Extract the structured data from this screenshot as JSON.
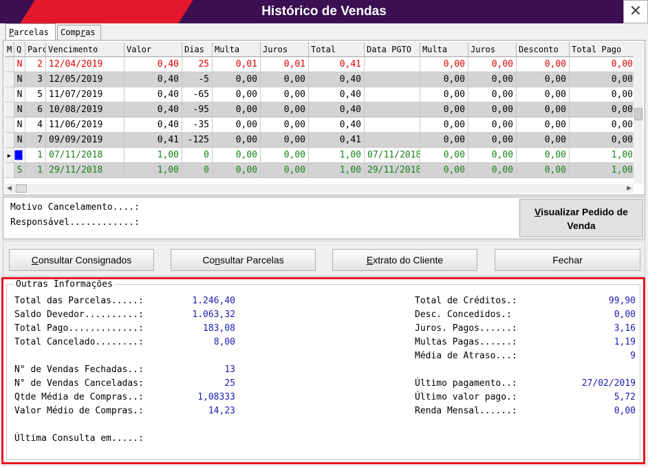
{
  "window": {
    "title": "Histórico de Vendas",
    "close_glyph": "✕"
  },
  "tabs": [
    {
      "pre": "",
      "accel": "P",
      "post": "arcelas"
    },
    {
      "pre": "Comp",
      "accel": "r",
      "post": "as"
    }
  ],
  "grid": {
    "headers": [
      "M",
      "Q",
      "Parc",
      "Vencimento",
      "Valor",
      "Dias",
      "Multa",
      "Juros",
      "Total",
      "Data PGTO",
      "Multa",
      "Juros",
      "Desconto",
      "Total Pago"
    ],
    "rows": [
      {
        "color": "red",
        "m": "",
        "q": "N",
        "parc": "2",
        "venc": "12/04/2019",
        "valor": "0,40",
        "dias": "25",
        "multa": "0,01",
        "juros": "0,01",
        "total": "0,41",
        "data_pgto": "",
        "multa2": "0,00",
        "juros2": "0,00",
        "desconto": "0,00",
        "total_pago": "0,00"
      },
      {
        "color": "black",
        "m": "",
        "q": "N",
        "parc": "3",
        "venc": "12/05/2019",
        "valor": "0,40",
        "dias": "-5",
        "multa": "0,00",
        "juros": "0,00",
        "total": "0,40",
        "data_pgto": "",
        "multa2": "0,00",
        "juros2": "0,00",
        "desconto": "0,00",
        "total_pago": "0,00"
      },
      {
        "color": "black",
        "m": "",
        "q": "N",
        "parc": "5",
        "venc": "11/07/2019",
        "valor": "0,40",
        "dias": "-65",
        "multa": "0,00",
        "juros": "0,00",
        "total": "0,40",
        "data_pgto": "",
        "multa2": "0,00",
        "juros2": "0,00",
        "desconto": "0,00",
        "total_pago": "0,00"
      },
      {
        "color": "black",
        "m": "",
        "q": "N",
        "parc": "6",
        "venc": "10/08/2019",
        "valor": "0,40",
        "dias": "-95",
        "multa": "0,00",
        "juros": "0,00",
        "total": "0,40",
        "data_pgto": "",
        "multa2": "0,00",
        "juros2": "0,00",
        "desconto": "0,00",
        "total_pago": "0,00"
      },
      {
        "color": "black",
        "m": "",
        "q": "N",
        "parc": "4",
        "venc": "11/06/2019",
        "valor": "0,40",
        "dias": "-35",
        "multa": "0,00",
        "juros": "0,00",
        "total": "0,40",
        "data_pgto": "",
        "multa2": "0,00",
        "juros2": "0,00",
        "desconto": "0,00",
        "total_pago": "0,00"
      },
      {
        "color": "black",
        "m": "",
        "q": "N",
        "parc": "7",
        "venc": "09/09/2019",
        "valor": "0,41",
        "dias": "-125",
        "multa": "0,00",
        "juros": "0,00",
        "total": "0,41",
        "data_pgto": "",
        "multa2": "0,00",
        "juros2": "0,00",
        "desconto": "0,00",
        "total_pago": "0,00"
      },
      {
        "color": "green",
        "m": "",
        "q": "S",
        "parc": "1",
        "venc": "07/11/2018",
        "valor": "1,00",
        "dias": "0",
        "multa": "0,00",
        "juros": "0,00",
        "total": "1,00",
        "data_pgto": "07/11/2018",
        "multa2": "0,00",
        "juros2": "0,00",
        "desconto": "0,00",
        "total_pago": "1,00",
        "current": true
      },
      {
        "color": "green",
        "m": "",
        "q": "S",
        "parc": "1",
        "venc": "29/11/2018",
        "valor": "1,00",
        "dias": "0",
        "multa": "0,00",
        "juros": "0,00",
        "total": "1,00",
        "data_pgto": "29/11/2018",
        "multa2": "0,00",
        "juros2": "0,00",
        "desconto": "0,00",
        "total_pago": "1,00"
      }
    ]
  },
  "cancel": {
    "motivo": "Motivo Cancelamento....:",
    "responsavel": "Responsável............:",
    "view_order_pre": "",
    "view_order_accel": "V",
    "view_order_post": "isualizar Pedido de Venda"
  },
  "buttons": [
    {
      "name": "consultar-consignados-button",
      "pre": "",
      "accel": "C",
      "post": "onsultar Consignados"
    },
    {
      "name": "consultar-parcelas-button",
      "pre": "Co",
      "accel": "n",
      "post": "sultar Parcelas"
    },
    {
      "name": "extrato-cliente-button",
      "pre": "",
      "accel": "E",
      "post": "xtrato do Cliente"
    },
    {
      "name": "fechar-button",
      "pre": "Fechar",
      "accel": "",
      "post": ""
    }
  ],
  "info": {
    "legend": "Outras Informações",
    "left": [
      {
        "label": "Total das Parcelas.....:",
        "value": "1.246,40"
      },
      {
        "label": "Saldo Devedor..........:",
        "value": "1.063,32"
      },
      {
        "label": "Total Pago.............:",
        "value": "183,08"
      },
      {
        "label": "Total Cancelado........:",
        "value": "8,00"
      },
      {
        "label": "N° de Vendas Fechadas..:",
        "value": "13"
      },
      {
        "label": "N° de Vendas Canceladas:",
        "value": "25"
      },
      {
        "label": "Qtde Média de Compras..:",
        "value": "1,08333"
      },
      {
        "label": "Valor Médio de Compras.:",
        "value": "14,23"
      },
      {
        "label": "Última Consulta em.....:",
        "value": ""
      }
    ],
    "right": [
      {
        "label": "Total de Créditos.:",
        "value": "99,90"
      },
      {
        "label": "Desc. Concedidos.:",
        "value": "0,00"
      },
      {
        "label": "Juros. Pagos......:",
        "value": "3,16"
      },
      {
        "label": "Multas Pagas......:",
        "value": "1,19"
      },
      {
        "label": "Média de Atraso...:",
        "value": "9"
      },
      {
        "label": "Último pagamento..:",
        "value": "27/02/2019"
      },
      {
        "label": "Último valor pago.:",
        "value": "5,72"
      },
      {
        "label": "Renda Mensal......:",
        "value": "0,00"
      }
    ]
  }
}
